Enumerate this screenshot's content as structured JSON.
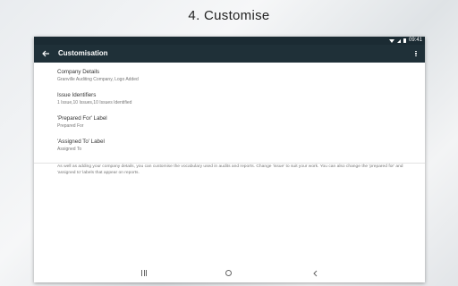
{
  "caption": "4.  Customise",
  "status_bar": {
    "time": "09:41"
  },
  "app_bar": {
    "title": "Customisation"
  },
  "settings": [
    {
      "title": "Company Details",
      "subtitle": "Granville Auditing Company, Logo Added"
    },
    {
      "title": "Issue Identifiers",
      "subtitle": "1 Issue,10 Issues,10 Issues Identified"
    },
    {
      "title": "'Prepared For' Label",
      "subtitle": "Prepared For"
    },
    {
      "title": "'Assigned To' Label",
      "subtitle": "Assigned To"
    }
  ],
  "description": "As well as adding your company details, you can customise the vocabulary used in audits and reports. Change 'issue' to suit your work. You can also change the 'prepared for' and 'assigned to' labels that appear on reports.",
  "colors": {
    "app_bar": "#1f3038",
    "status_bar": "#1b2b33"
  }
}
